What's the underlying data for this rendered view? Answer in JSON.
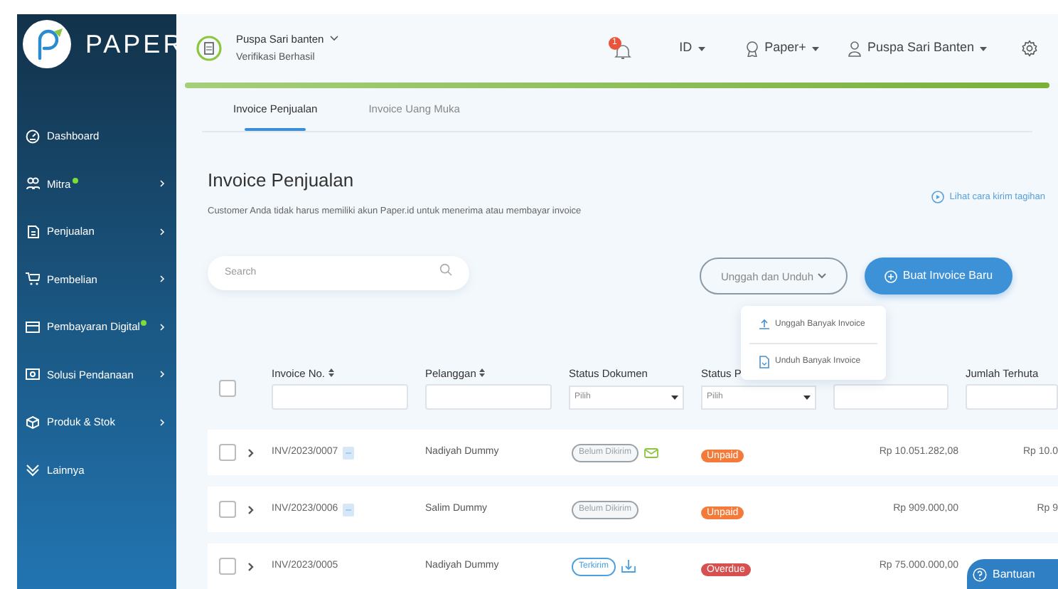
{
  "logo": {
    "text": "PAPER"
  },
  "sidebar": {
    "items": [
      {
        "label": "Dashboard",
        "dot": false,
        "arrow": false
      },
      {
        "label": "Mitra",
        "dot": true,
        "arrow": true
      },
      {
        "label": "Penjualan",
        "dot": false,
        "arrow": true
      },
      {
        "label": "Pembelian",
        "dot": false,
        "arrow": true
      },
      {
        "label": "Pembayaran Digital",
        "dot": true,
        "arrow": true
      },
      {
        "label": "Solusi Pendanaan",
        "dot": false,
        "arrow": true
      },
      {
        "label": "Produk & Stok",
        "dot": false,
        "arrow": true
      },
      {
        "label": "Lainnya",
        "dot": false,
        "arrow": false
      }
    ]
  },
  "header": {
    "company": "Puspa Sari banten",
    "verification": "Verifikasi Berhasil",
    "notification_count": "1",
    "language": "ID",
    "plan": "Paper+",
    "user": "Puspa Sari Banten"
  },
  "tabs": [
    {
      "label": "Invoice Penjualan",
      "selected": true
    },
    {
      "label": "Invoice Uang Muka",
      "selected": false
    }
  ],
  "page": {
    "title": "Invoice Penjualan",
    "subtitle": "Customer Anda tidak harus memiliki akun Paper.id untuk menerima atau membayar invoice",
    "help_link": "Lihat cara kirim tagihan"
  },
  "search": {
    "placeholder": "Search"
  },
  "upload_download_button": "Unggah dan Unduh",
  "new_invoice_button": "Buat Invoice Baru",
  "upload_menu": [
    {
      "label": "Unggah Banyak Invoice"
    },
    {
      "label": "Unduh Banyak Invoice"
    }
  ],
  "table": {
    "select_all_checked": false,
    "columns": [
      {
        "label": "Invoice No.",
        "sortable": true,
        "kind": "text"
      },
      {
        "label": "Pelanggan",
        "sortable": true,
        "kind": "text"
      },
      {
        "label": "Status Dokumen",
        "sortable": false,
        "kind": "select",
        "placeholder": "Pilih"
      },
      {
        "label": "Status P",
        "kind": "select",
        "placeholder": "Pilih"
      },
      {
        "kind": "text"
      },
      {
        "label": "Jumlah Terhuta",
        "sortable": false,
        "kind": "text"
      }
    ],
    "rows": [
      {
        "checked": false,
        "invoice_no": "INV/2023/0007",
        "note": true,
        "customer": "Nadiyah Dummy",
        "doc_status": {
          "label": "Belum Dikirim",
          "kind": "unsent"
        },
        "doc_action": {
          "kind": "email"
        },
        "payment_status": {
          "label": "Unpaid",
          "kind": "unpaid"
        },
        "amount": "Rp 10.051.282,08",
        "outstanding": "Rp 10.0"
      },
      {
        "checked": false,
        "invoice_no": "INV/2023/0006",
        "note": true,
        "customer": "Salim Dummy",
        "doc_status": {
          "label": "Belum Dikirim",
          "kind": "unsent"
        },
        "payment_status": {
          "label": "Unpaid",
          "kind": "unpaid"
        },
        "amount": "Rp 909.000,00",
        "outstanding": "Rp 9"
      },
      {
        "checked": false,
        "invoice_no": "INV/2023/0005",
        "note": false,
        "customer": "Nadiyah Dummy",
        "doc_status": {
          "label": "Terkirim",
          "kind": "sent"
        },
        "doc_action": {
          "kind": "inbox"
        },
        "payment_status": {
          "label": "Overdue",
          "kind": "overdue"
        },
        "amount": "Rp 75.000.000,00"
      }
    ]
  },
  "help_button": "Bantuan"
}
